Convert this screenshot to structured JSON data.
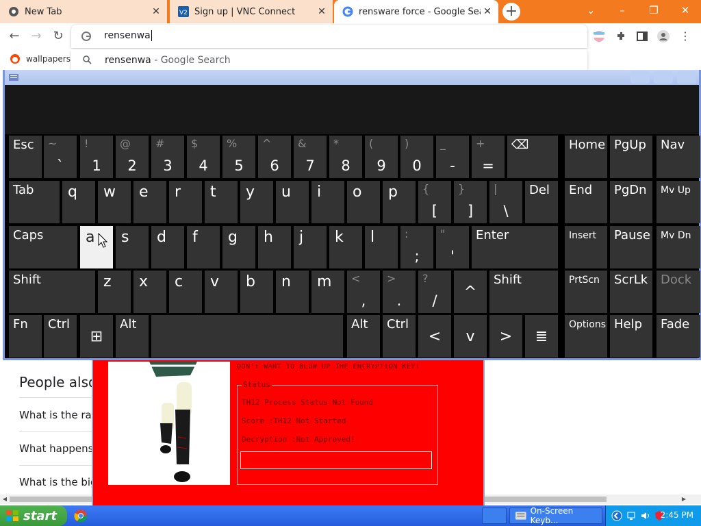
{
  "browser": {
    "tabs": [
      {
        "title": "New Tab",
        "active": false
      },
      {
        "title": "Sign up | VNC Connect",
        "active": false
      },
      {
        "title": "rensware force - Google Search",
        "active": true
      }
    ],
    "new_tab_label": "+",
    "window_controls": {
      "minimize": "⌄",
      "restore": "–",
      "maximize": "❐",
      "close": "✕"
    },
    "nav": {
      "back": "←",
      "forward": "→",
      "reload": "↻"
    },
    "omnibox": {
      "value": "rensenwa"
    },
    "suggestion": {
      "typed": "rensenwa",
      "suffix": " - Google Search"
    },
    "bookmarks": [
      {
        "label": "wallpapers"
      }
    ]
  },
  "page": {
    "people_also_ask": "People also",
    "questions": [
      "What is the rar",
      "What happens",
      "What is the big"
    ]
  },
  "ransom": {
    "warning": "DON'T WANT TO BLOW UP THE ENCRYPTION KEY!",
    "status_legend": "Status",
    "rows": [
      "TH12 Process Status Not Found",
      "Score :TH12 Not Started",
      "Decryption :Not Approved!"
    ],
    "progress_fraction": 0
  },
  "keyboard": {
    "title": "On-Screen Keyboard",
    "rows": {
      "r1": [
        {
          "label": "Esc"
        },
        {
          "sec": "~",
          "main": "`"
        },
        {
          "sec": "!",
          "main": "1"
        },
        {
          "sec": "@",
          "main": "2"
        },
        {
          "sec": "#",
          "main": "3"
        },
        {
          "sec": "$",
          "main": "4"
        },
        {
          "sec": "%",
          "main": "5"
        },
        {
          "sec": "^",
          "main": "6"
        },
        {
          "sec": "&",
          "main": "7"
        },
        {
          "sec": "*",
          "main": "8"
        },
        {
          "sec": "(",
          "main": "9"
        },
        {
          "sec": ")",
          "main": "0"
        },
        {
          "sec": "_",
          "main": "-"
        },
        {
          "sec": "+",
          "main": "="
        },
        {
          "label": "⌫"
        }
      ],
      "r2": [
        {
          "label": "Tab"
        },
        {
          "char": "q"
        },
        {
          "char": "w"
        },
        {
          "char": "e"
        },
        {
          "char": "r"
        },
        {
          "char": "t"
        },
        {
          "char": "y"
        },
        {
          "char": "u"
        },
        {
          "char": "i"
        },
        {
          "char": "o"
        },
        {
          "char": "p"
        },
        {
          "sec": "{",
          "main": "["
        },
        {
          "sec": "}",
          "main": "]"
        },
        {
          "sec": "|",
          "main": "\\"
        },
        {
          "label": "Del"
        }
      ],
      "r3": [
        {
          "label": "Caps"
        },
        {
          "char": "a"
        },
        {
          "char": "s"
        },
        {
          "char": "d"
        },
        {
          "char": "f"
        },
        {
          "char": "g"
        },
        {
          "char": "h"
        },
        {
          "char": "j"
        },
        {
          "char": "k"
        },
        {
          "char": "l"
        },
        {
          "sec": ":",
          "main": ";"
        },
        {
          "sec": "\"",
          "main": "'"
        },
        {
          "label": "Enter"
        }
      ],
      "r4": [
        {
          "label": "Shift"
        },
        {
          "char": "z"
        },
        {
          "char": "x"
        },
        {
          "char": "c"
        },
        {
          "char": "v"
        },
        {
          "char": "b"
        },
        {
          "char": "n"
        },
        {
          "char": "m"
        },
        {
          "sec": "<",
          "main": ","
        },
        {
          "sec": ">",
          "main": "."
        },
        {
          "sec": "?",
          "main": "/"
        },
        {
          "center": "^"
        },
        {
          "label": "Shift"
        }
      ],
      "r5": [
        {
          "label": "Fn"
        },
        {
          "label": "Ctrl"
        },
        {
          "center": "⊞"
        },
        {
          "label": "Alt"
        },
        {
          "label": ""
        },
        {
          "label": "Alt"
        },
        {
          "label": "Ctrl"
        },
        {
          "center": "<"
        },
        {
          "center": "v"
        },
        {
          "center": ">"
        },
        {
          "center": "≣"
        }
      ],
      "nav": [
        [
          {
            "label": "Home"
          },
          {
            "label": "PgUp"
          },
          {
            "label": "Nav"
          }
        ],
        [
          {
            "label": "End"
          },
          {
            "label": "PgDn"
          },
          {
            "label": "Mv Up"
          }
        ],
        [
          {
            "label": "Insert"
          },
          {
            "label": "Pause"
          },
          {
            "label": "Mv Dn"
          }
        ],
        [
          {
            "label": "PrtScn"
          },
          {
            "label": "ScrLk"
          },
          {
            "label": "Dock"
          }
        ],
        [
          {
            "label": "Options"
          },
          {
            "label": "Help"
          },
          {
            "label": "Fade"
          }
        ]
      ]
    },
    "pressed_key": "a"
  },
  "taskbar": {
    "start_label": "start",
    "tasks": [
      {
        "label": "On-Screen Keyb..."
      }
    ],
    "clock": "2:45 PM"
  },
  "colors": {
    "tabstrip": "#f47a20",
    "ransom_bg": "#fe0000",
    "osk_key": "#333333",
    "taskbar": "#245ddb"
  }
}
